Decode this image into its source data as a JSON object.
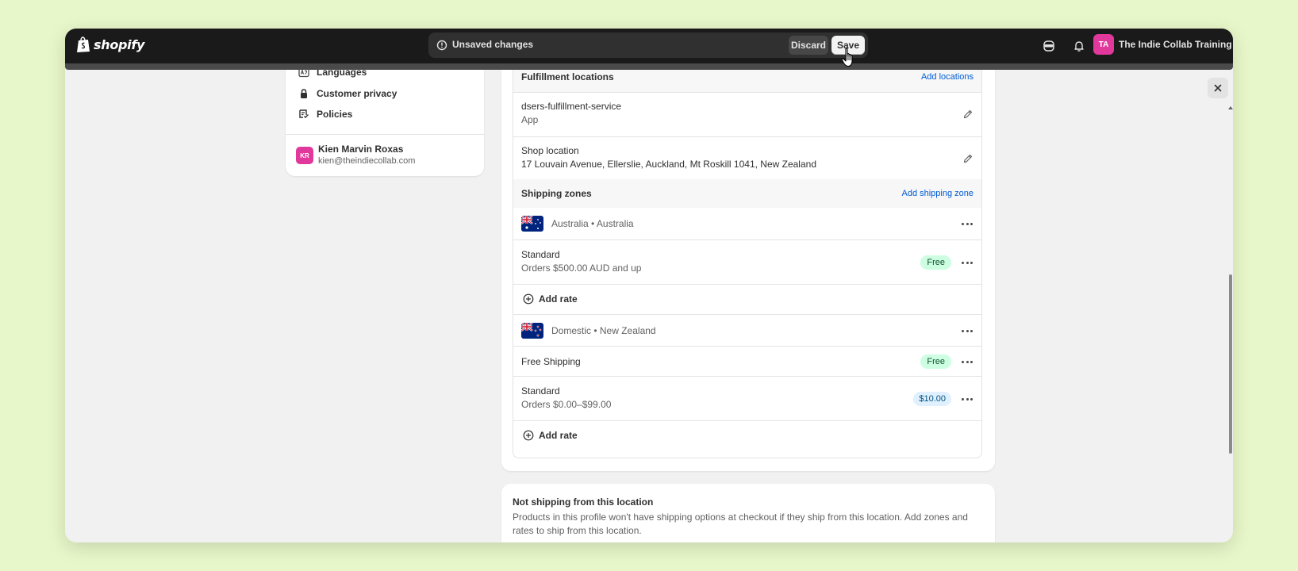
{
  "topbar": {
    "brand": "shopify",
    "unsaved_message": "Unsaved changes",
    "discard_label": "Discard",
    "save_label": "Save",
    "avatar_initials": "TA",
    "store_name": "The Indie Collab Training ..."
  },
  "sidebar": {
    "items": [
      {
        "label": "Languages",
        "icon": "languages-icon"
      },
      {
        "label": "Customer privacy",
        "icon": "lock-icon"
      },
      {
        "label": "Policies",
        "icon": "policies-icon"
      }
    ],
    "user": {
      "initials": "KR",
      "name": "Kien Marvin Roxas",
      "email": "kien@theindiecollab.com"
    }
  },
  "fulfillment": {
    "title": "Fulfillment locations",
    "action": "Add locations",
    "locations": [
      {
        "name": "dsers-fulfillment-service",
        "detail": "App"
      },
      {
        "name": "Shop location",
        "detail": "17 Louvain Avenue, Ellerslie, Auckland, Mt Roskill 1041, New Zealand"
      }
    ]
  },
  "shipping": {
    "title": "Shipping zones",
    "action": "Add shipping zone",
    "zones": [
      {
        "name": "Australia • Australia",
        "flag": "australia-flag",
        "rates": [
          {
            "name": "Standard",
            "condition": "Orders $500.00 AUD and up",
            "price": "Free"
          }
        ],
        "add_rate_label": "Add rate"
      },
      {
        "name": "Domestic • New Zealand",
        "flag": "new-zealand-flag",
        "rates": [
          {
            "name": "Free Shipping",
            "condition": "",
            "price": "Free"
          },
          {
            "name": "Standard",
            "condition": "Orders $0.00–$99.00",
            "price": "$10.00"
          }
        ],
        "add_rate_label": "Add rate"
      }
    ]
  },
  "not_shipping": {
    "title": "Not shipping from this location",
    "description": "Products in this profile won't have shipping options at checkout if they ship from this location. Add zones and rates to ship from this location."
  },
  "colors": {
    "background": "#e8f7c9",
    "topbar": "#1a1a1a",
    "link": "#005bd3",
    "free_badge": "#cdfee1",
    "price_badge": "#e0f0ff",
    "avatar": "#e0389b"
  }
}
